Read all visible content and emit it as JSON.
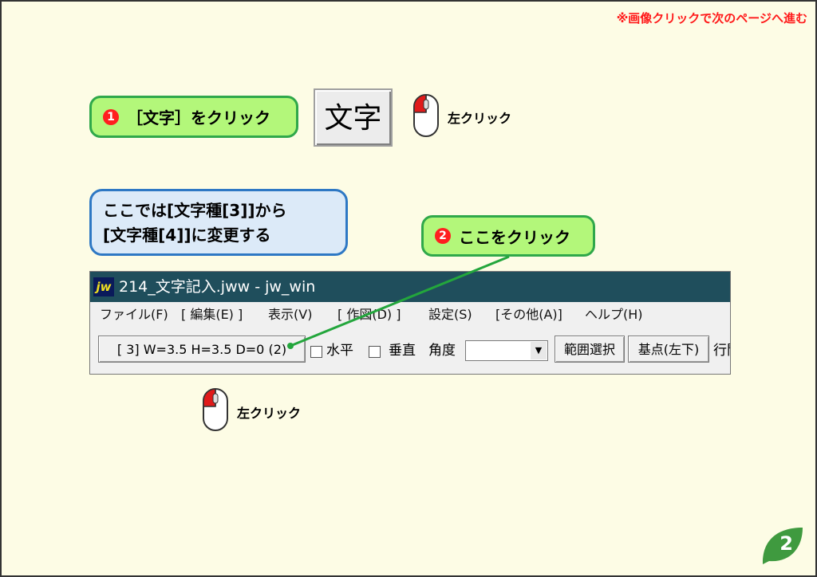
{
  "top_note": "※画像クリックで次のページへ進む",
  "step1": {
    "number": "1",
    "text": "［文字］をクリック"
  },
  "moji_button_label": "文字",
  "mouse_label_1": "左クリック",
  "info_box": {
    "line1": "ここでは[文字種[3]]から",
    "line2": "[文字種[4]]に変更する"
  },
  "step2": {
    "number": "2",
    "text": "ここをクリック"
  },
  "window": {
    "title": "214_文字記入.jww - jw_win",
    "logo": "jw",
    "menu": [
      "ファイル(F)",
      "[ 編集(E) ]",
      "表示(V)",
      "[ 作図(D) ]",
      "設定(S)",
      "[その他(A)]",
      "ヘルプ(H)"
    ],
    "toolbar": {
      "size_button": "[ 3]  W=3.5  H=3.5  D=0 (2)",
      "horizontal": "水平",
      "vertical": "垂直",
      "angle": "角度",
      "range_select": "範囲選択",
      "base_point": "基点(左下)",
      "cut_text": "行間"
    }
  },
  "mouse_label_2": "左クリック",
  "page_number": "2"
}
